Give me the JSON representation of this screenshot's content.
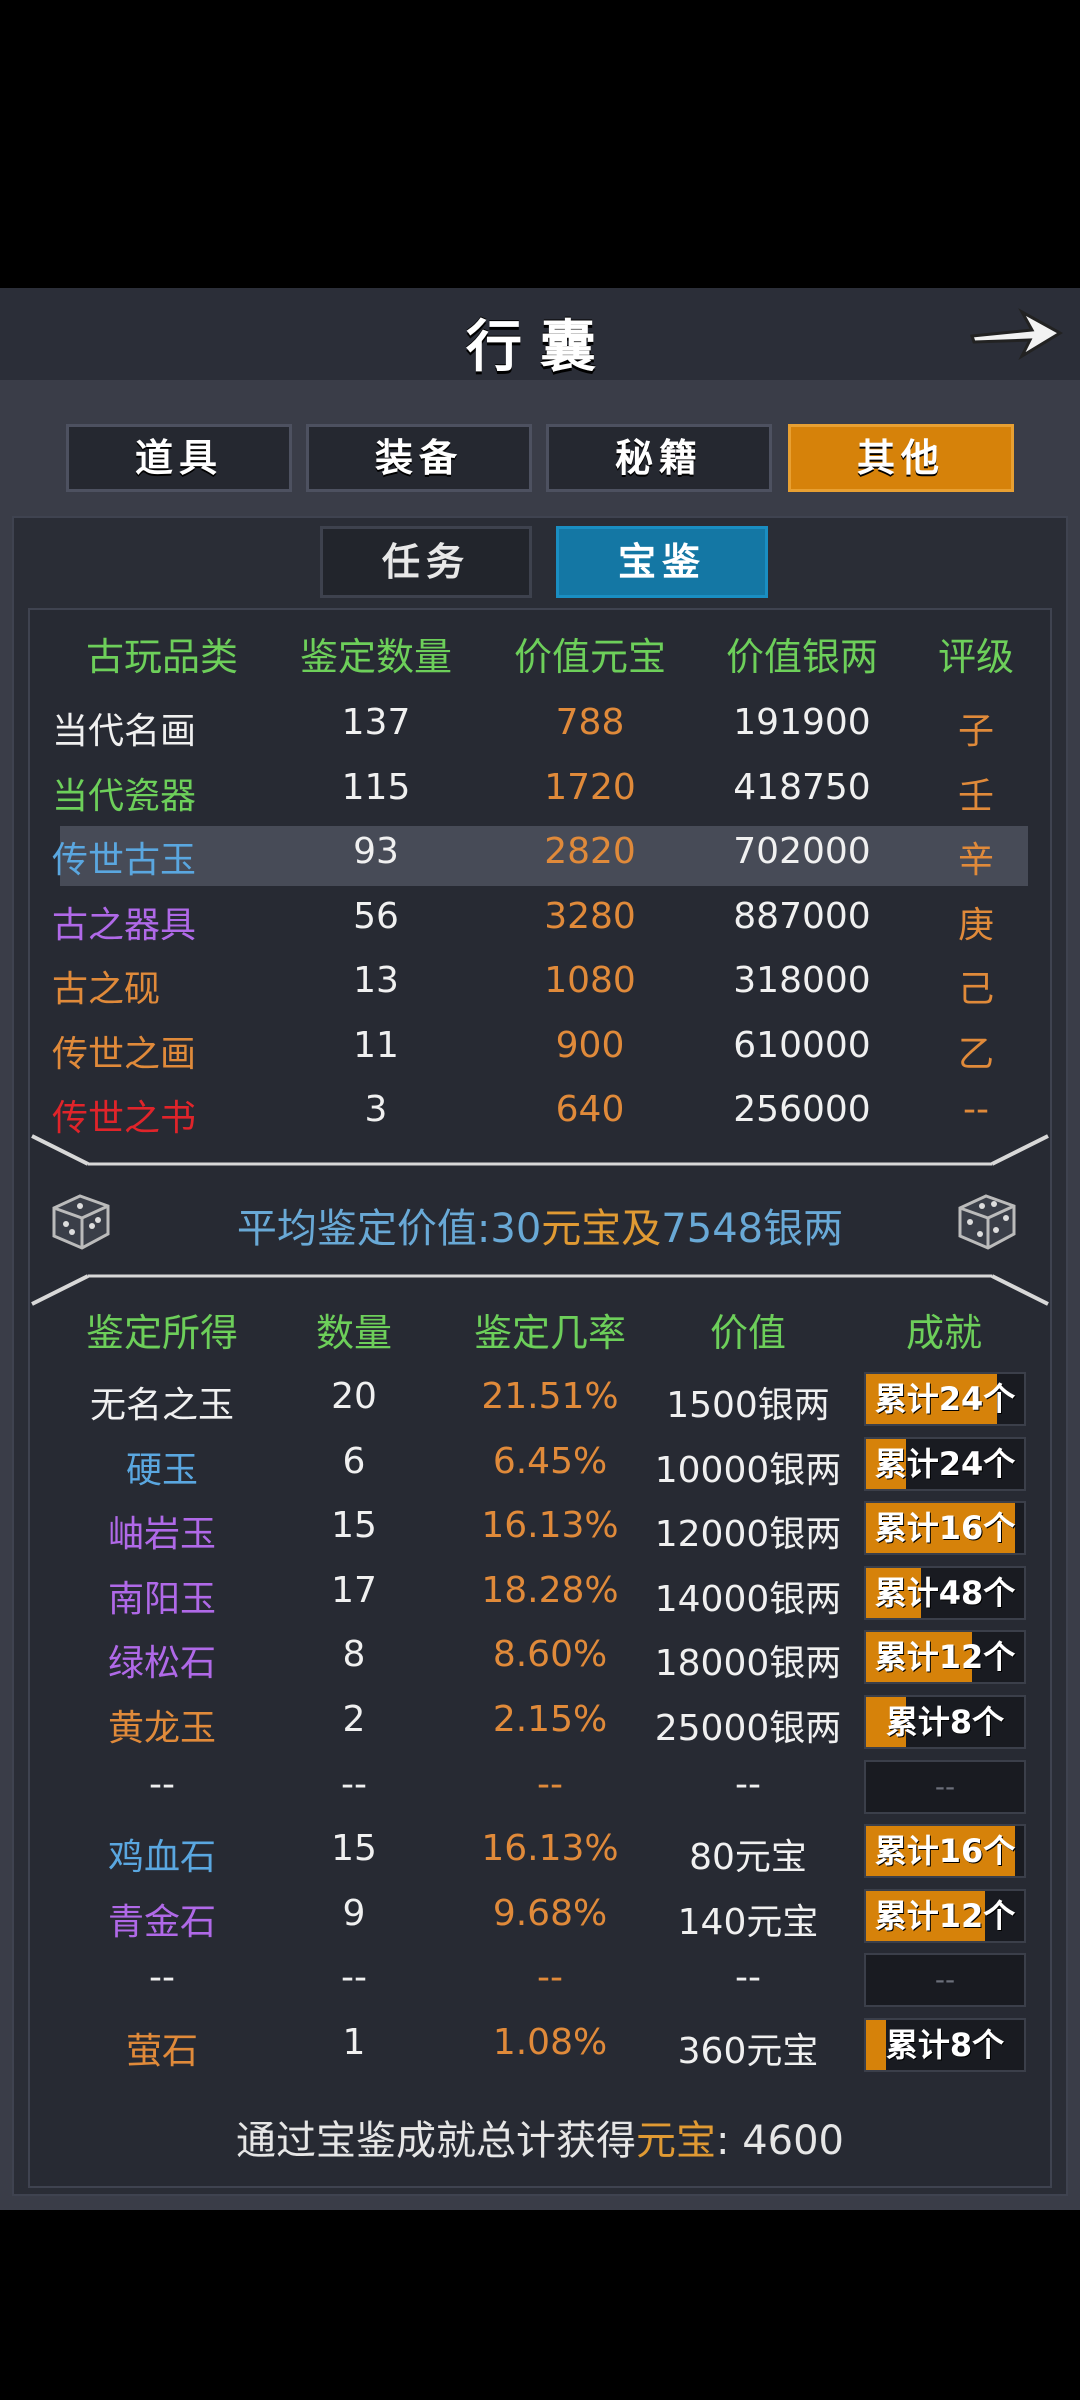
{
  "title": "行囊",
  "tabs": [
    {
      "label": "道具",
      "active": false
    },
    {
      "label": "装备",
      "active": false
    },
    {
      "label": "秘籍",
      "active": false
    },
    {
      "label": "其他",
      "active": true
    }
  ],
  "subtabs": [
    {
      "label": "任务",
      "active": false
    },
    {
      "label": "宝鉴",
      "active": true
    }
  ],
  "colors": {
    "green": "#6dcf5a",
    "blue": "#5aa7e0",
    "purple": "#b069e8",
    "orange": "#e08a3a",
    "red": "#e0242a",
    "white": "#f0f0f0",
    "accent": "#d6820a"
  },
  "antiques": {
    "headers": [
      "古玩品类",
      "鉴定数量",
      "价值元宝",
      "价值银两",
      "评级"
    ],
    "rows": [
      {
        "name": "当代名画",
        "count": "137",
        "yuanbao": "788",
        "silver": "191900",
        "grade": "子",
        "color": "white"
      },
      {
        "name": "当代瓷器",
        "count": "115",
        "yuanbao": "1720",
        "silver": "418750",
        "grade": "壬",
        "color": "green"
      },
      {
        "name": "传世古玉",
        "count": "93",
        "yuanbao": "2820",
        "silver": "702000",
        "grade": "辛",
        "color": "blue"
      },
      {
        "name": "古之器具",
        "count": "56",
        "yuanbao": "3280",
        "silver": "887000",
        "grade": "庚",
        "color": "purple"
      },
      {
        "name": "古之砚",
        "count": "13",
        "yuanbao": "1080",
        "silver": "318000",
        "grade": "己",
        "color": "orange"
      },
      {
        "name": "传世之画",
        "count": "11",
        "yuanbao": "900",
        "silver": "610000",
        "grade": "乙",
        "color": "orange"
      },
      {
        "name": "传世之书",
        "count": "3",
        "yuanbao": "640",
        "silver": "256000",
        "grade": "--",
        "color": "red"
      }
    ]
  },
  "average": {
    "prefix": "平均鉴定价值:",
    "amount1": "30",
    "unit1": "元宝",
    "joiner": "及",
    "amount2": "7548",
    "unit2": "银两"
  },
  "results": {
    "headers": [
      "鉴定所得",
      "数量",
      "鉴定几率",
      "价值",
      "成就"
    ],
    "rows": [
      {
        "name": "无名之玉",
        "count": "20",
        "rate": "21.51%",
        "value": "1500银两",
        "ach": "累计24个",
        "progress": 0.83,
        "color": "white"
      },
      {
        "name": "硬玉",
        "count": "6",
        "rate": "6.45%",
        "value": "10000银两",
        "ach": "累计24个",
        "progress": 0.25,
        "color": "blue"
      },
      {
        "name": "岫岩玉",
        "count": "15",
        "rate": "16.13%",
        "value": "12000银两",
        "ach": "累计16个",
        "progress": 0.94,
        "color": "purple"
      },
      {
        "name": "南阳玉",
        "count": "17",
        "rate": "18.28%",
        "value": "14000银两",
        "ach": "累计48个",
        "progress": 0.35,
        "color": "purple"
      },
      {
        "name": "绿松石",
        "count": "8",
        "rate": "8.60%",
        "value": "18000银两",
        "ach": "累计12个",
        "progress": 0.67,
        "color": "purple"
      },
      {
        "name": "黄龙玉",
        "count": "2",
        "rate": "2.15%",
        "value": "25000银两",
        "ach": "累计8个",
        "progress": 0.25,
        "color": "orange"
      },
      {
        "name": "--",
        "count": "--",
        "rate": "--",
        "value": "--",
        "ach": "--",
        "progress": 0,
        "color": "white"
      },
      {
        "name": "鸡血石",
        "count": "15",
        "rate": "16.13%",
        "value": "80元宝",
        "ach": "累计16个",
        "progress": 0.94,
        "color": "blue"
      },
      {
        "name": "青金石",
        "count": "9",
        "rate": "9.68%",
        "value": "140元宝",
        "ach": "累计12个",
        "progress": 0.75,
        "color": "purple"
      },
      {
        "name": "--",
        "count": "--",
        "rate": "--",
        "value": "--",
        "ach": "--",
        "progress": 0,
        "color": "white"
      },
      {
        "name": "萤石",
        "count": "1",
        "rate": "1.08%",
        "value": "360元宝",
        "ach": "累计8个",
        "progress": 0.125,
        "color": "orange"
      }
    ]
  },
  "footer": {
    "prefix": "通过宝鉴成就总计获得",
    "unit": "元宝",
    "value": ": 4600"
  }
}
